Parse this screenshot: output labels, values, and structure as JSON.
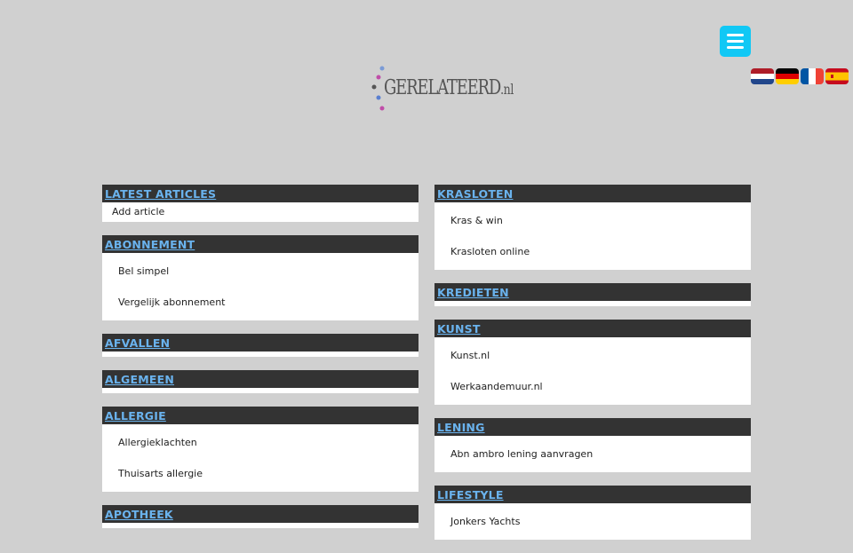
{
  "header": {
    "logo_main": "GERELATEERD",
    "logo_suffix": ".nl",
    "menu_icon": "hamburger-icon",
    "flags": [
      {
        "lang": "nl",
        "icon": "flag-nl-icon"
      },
      {
        "lang": "de",
        "icon": "flag-de-icon"
      },
      {
        "lang": "fr",
        "icon": "flag-fr-icon"
      },
      {
        "lang": "es",
        "icon": "flag-es-icon"
      }
    ],
    "accent_color": "#11c8f5"
  },
  "left_column": [
    {
      "title": "LATEST ARTICLES",
      "items": [
        "Add article"
      ]
    },
    {
      "title": "ABONNEMENT",
      "items": [
        "Bel simpel",
        "Vergelijk abonnement"
      ]
    },
    {
      "title": "AFVALLEN",
      "items": []
    },
    {
      "title": "ALGEMEEN",
      "items": []
    },
    {
      "title": "ALLERGIE",
      "items": [
        "Allergieklachten",
        "Thuisarts allergie"
      ]
    },
    {
      "title": "APOTHEEK",
      "items": []
    }
  ],
  "right_column": [
    {
      "title": "KRASLOTEN",
      "items": [
        "Kras & win",
        "Krasloten online"
      ]
    },
    {
      "title": "KREDIETEN",
      "items": []
    },
    {
      "title": "KUNST",
      "items": [
        "Kunst.nl",
        "Werkaandemuur.nl"
      ]
    },
    {
      "title": "LENING",
      "items": [
        "Abn ambro lening aanvragen"
      ]
    },
    {
      "title": "LIFESTYLE",
      "items": [
        "Jonkers Yachts"
      ]
    }
  ]
}
